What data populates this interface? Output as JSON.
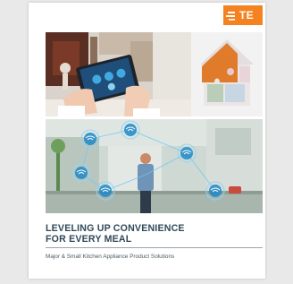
{
  "brand": {
    "logo_text": "TE",
    "color": "#f58220"
  },
  "cover": {
    "title_line1": "LEVELING UP CONVENIENCE",
    "title_line2": "FOR EVERY MEAL",
    "subtitle": "Major & Small Kitchen Appliance Product Solutions",
    "title_color": "#2f4859"
  },
  "images": {
    "top_photo": "hands-holding-tablet-in-kitchen",
    "puzzle": "house-shaped-puzzle-pieces",
    "bottom_photo": "woman-in-connected-kitchen"
  },
  "icons": [
    "wifi-icon",
    "wifi-icon",
    "wifi-icon",
    "wifi-icon",
    "wifi-icon",
    "wifi-icon"
  ]
}
